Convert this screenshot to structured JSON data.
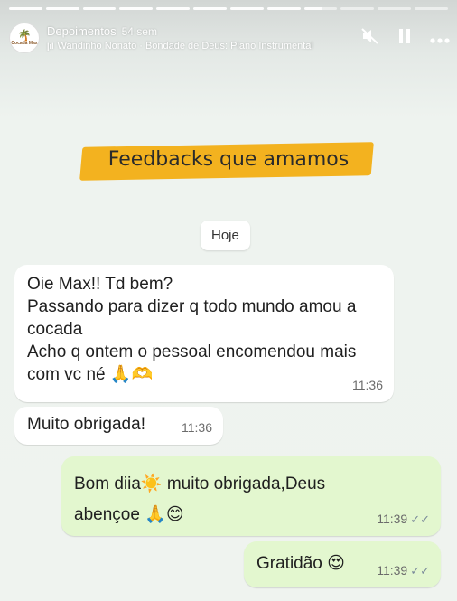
{
  "story": {
    "account": "Depoimentos",
    "time_ago": "54 sem",
    "music": "Wandinho Nonato · Bondade de Deus: Piano Instrumental",
    "avatar_brand": "Cocada Max",
    "progress_segments": 12,
    "progress_done": 8
  },
  "icons": {
    "mute": "speaker-muted-icon",
    "pause": "pause-icon",
    "more": "more-options-icon",
    "music": "music-icon"
  },
  "banner": {
    "text": "Feedbacks que amamos",
    "color": "#f3b21f"
  },
  "chat": {
    "date_label": "Hoje",
    "messages": [
      {
        "direction": "in",
        "lines": [
          "Oie Max!! Td bem?",
          "Passando para dizer q todo mundo amou a cocada",
          "Acho q ontem o pessoal encomendou mais com vc né 🙏🫶"
        ],
        "time": "11:36"
      },
      {
        "direction": "in",
        "text": "Muito obrigada!",
        "time": "11:36"
      },
      {
        "direction": "out",
        "text": "Bom diia☀️ muito obrigada,Deus abençoe 🙏😊",
        "time": "11:39",
        "status": "✓✓"
      },
      {
        "direction": "out",
        "text": "Gratidão 😍",
        "time": "11:39",
        "status": "✓✓"
      }
    ]
  }
}
